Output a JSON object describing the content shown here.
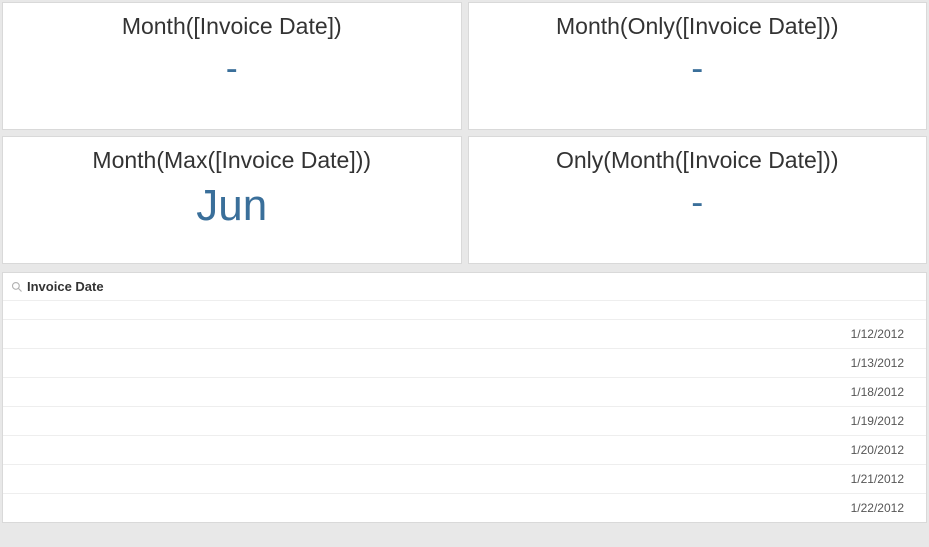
{
  "kpi": [
    {
      "title": "Month([Invoice Date])",
      "value": "-"
    },
    {
      "title": "Month(Only([Invoice Date]))",
      "value": "-"
    },
    {
      "title": "Month(Max([Invoice Date]))",
      "value": "Jun"
    },
    {
      "title": "Only(Month([Invoice Date]))",
      "value": "-"
    }
  ],
  "filter": {
    "field": "Invoice Date",
    "values": [
      "1/12/2012",
      "1/13/2012",
      "1/18/2012",
      "1/19/2012",
      "1/20/2012",
      "1/21/2012",
      "1/22/2012"
    ]
  }
}
